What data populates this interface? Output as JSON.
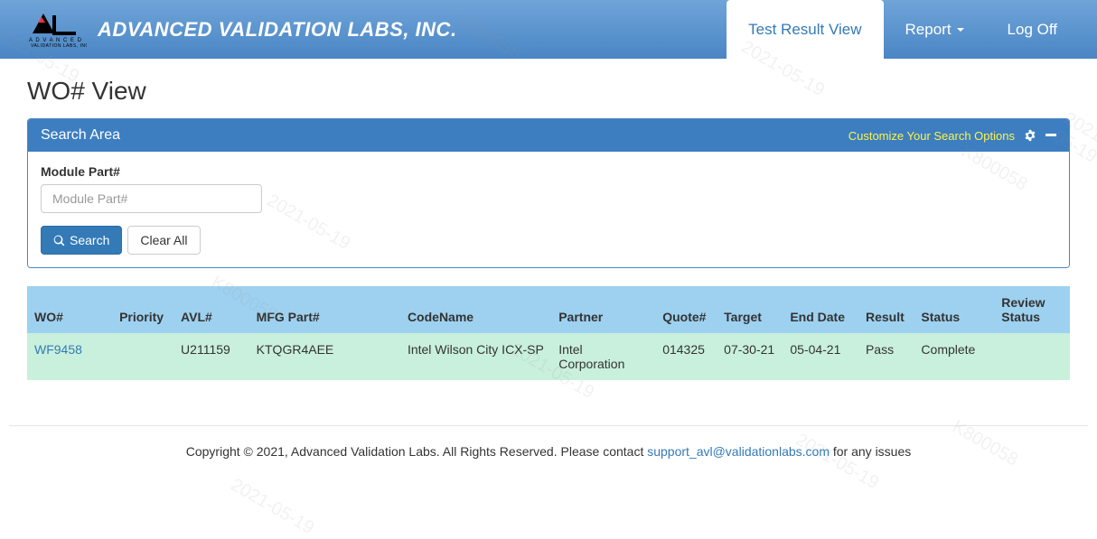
{
  "header": {
    "company": "ADVANCED VALIDATION LABS, INC.",
    "nav": {
      "test_result": "Test Result View",
      "report": "Report",
      "logoff": "Log Off"
    }
  },
  "page": {
    "title": "WO# View"
  },
  "search_panel": {
    "title": "Search Area",
    "customize": "Customize Your Search Options",
    "field_label": "Module Part#",
    "placeholder": "Module Part#",
    "search_btn": "Search",
    "clear_btn": "Clear All"
  },
  "table": {
    "headers": {
      "wo": "WO#",
      "priority": "Priority",
      "avl": "AVL#",
      "mfg": "MFG Part#",
      "codename": "CodeName",
      "partner": "Partner",
      "quote": "Quote#",
      "target": "Target",
      "end": "End Date",
      "result": "Result",
      "status": "Status",
      "review": "Review Status"
    },
    "rows": [
      {
        "wo": "WF9458",
        "priority": "",
        "avl": "U211159",
        "mfg": "KTQGR4AEE",
        "codename": "Intel Wilson City ICX-SP",
        "partner": "Intel Corporation",
        "quote": "014325",
        "target": "07-30-21",
        "end": "05-04-21",
        "result": "Pass",
        "status": "Complete",
        "review": ""
      }
    ]
  },
  "footer": {
    "text_before": "Copyright © 2021, Advanced Validation Labs. All Rights Reserved. Please contact ",
    "email": "support_avl@validationlabs.com",
    "text_after": " for any issues"
  },
  "watermark": {
    "date": "2021-05-19",
    "code": "K800058"
  }
}
